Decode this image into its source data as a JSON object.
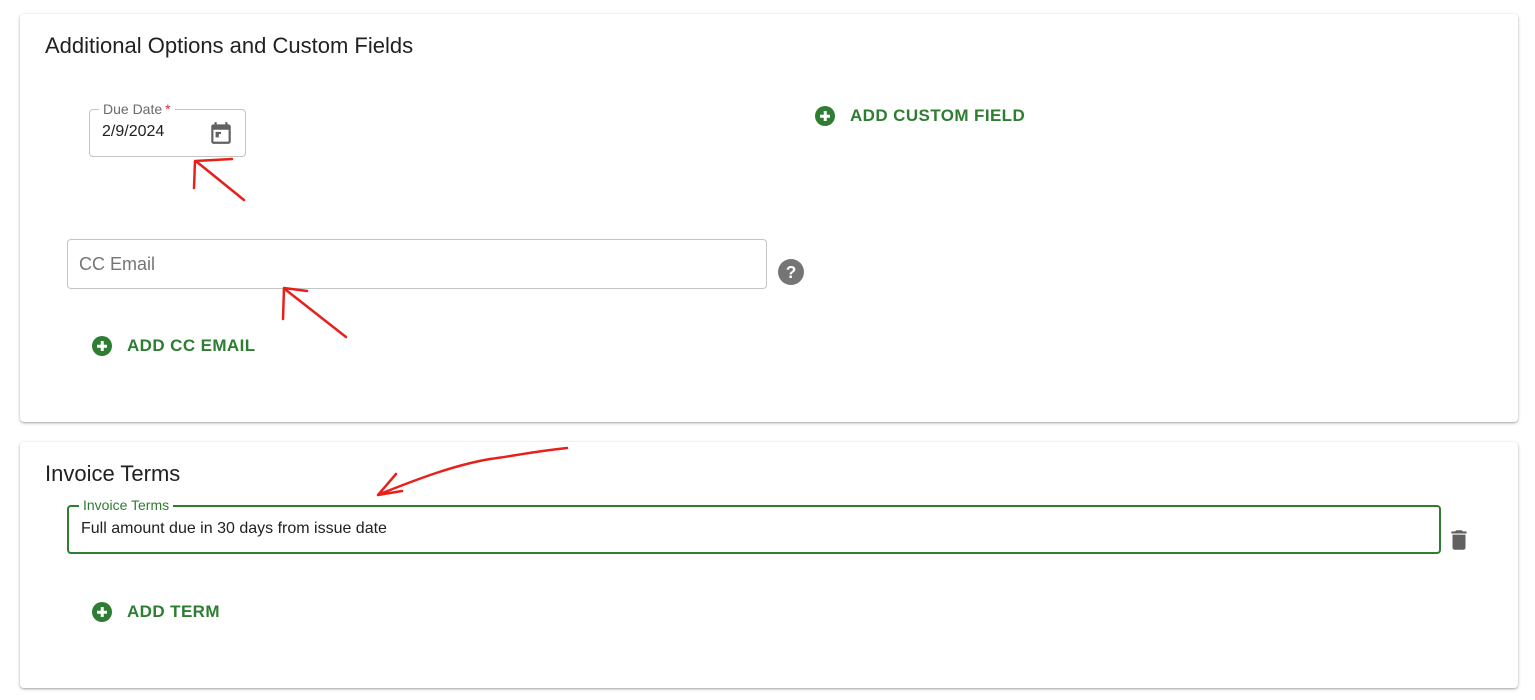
{
  "colors": {
    "accent": "#2e7d32",
    "icon_gray": "#616161",
    "help_icon": "#757575",
    "required": "#d32f2f",
    "annotation": "#e8201a"
  },
  "options_card": {
    "title": "Additional Options and Custom Fields",
    "due_date": {
      "label": "Due Date",
      "required_mark": "*",
      "value": "2/9/2024",
      "icon": "calendar-icon"
    },
    "add_custom_field": {
      "label": "ADD CUSTOM FIELD",
      "icon": "add-circle-icon"
    },
    "cc_email": {
      "placeholder": "CC Email",
      "value": "",
      "help_icon": "help-circle-icon"
    },
    "add_cc_email": {
      "label": "ADD CC EMAIL",
      "icon": "add-circle-icon"
    }
  },
  "terms_card": {
    "title": "Invoice Terms",
    "terms_field": {
      "label": "Invoice Terms",
      "value": "Full amount due in 30 days from issue date",
      "delete_icon": "trash-icon"
    },
    "add_term": {
      "label": "ADD TERM",
      "icon": "add-circle-icon"
    }
  }
}
